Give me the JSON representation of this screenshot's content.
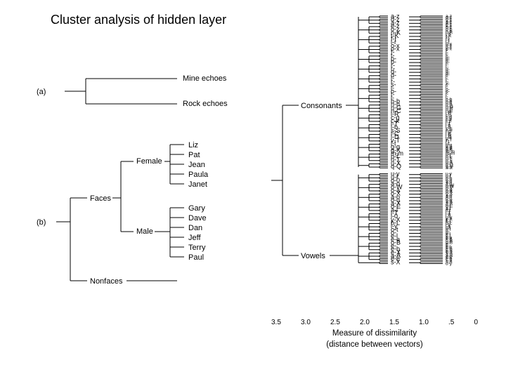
{
  "title": "Cluster analysis of hidden layer",
  "panel_a": {
    "tag": "(a)",
    "leaves": [
      "Mine echoes",
      "Rock echoes"
    ]
  },
  "panel_b": {
    "tag": "(b)",
    "root_labels": [
      "Faces",
      "Nonfaces"
    ],
    "gender": [
      "Female",
      "Male"
    ],
    "female": [
      "Liz",
      "Pat",
      "Jean",
      "Paula",
      "Janet"
    ],
    "male": [
      "Gary",
      "Dave",
      "Dan",
      "Jeff",
      "Terry",
      "Paul"
    ]
  },
  "panel_c": {
    "groups": [
      "Consonants",
      "Vowels"
    ],
    "consonants_pairs": [
      "a-z",
      "d-z",
      "a-z",
      "e-z",
      "o-z",
      "n-K",
      "t-K",
      "f-r",
      "l-r",
      "o-x",
      "o-x",
      "f-",
      "t-",
      "p-",
      "b-",
      "r-",
      "r-",
      "d-",
      "d-",
      "l-",
      "r-",
      "s-",
      "l-",
      "o-",
      "t-",
      "l-",
      "h-b",
      "h-h",
      "n-G",
      "n-C",
      "l-R",
      "c-q",
      "c-k",
      "l-T",
      "l-b",
      "s-S",
      "l-C",
      "l-D",
      "v-T",
      "l-t",
      "g-g",
      "g-K",
      "m-m",
      "p-f",
      "u-T",
      "u-X",
      "q-Q"
    ],
    "vowels_pairs": [
      "u-y",
      "u-l",
      "o-0",
      "a-o",
      "o-W",
      "o-a",
      "o-X",
      "a-o",
      "o-u",
      "a-X",
      "o-E",
      "a-l",
      "l-T",
      "l-0",
      "y-X",
      "b-L",
      "l-y",
      "o-t",
      "o-",
      "e-l",
      "e-e",
      "o-B",
      "e-",
      "e-b",
      "e-X",
      "a-A",
      "e-e",
      "s-X"
    ]
  },
  "axis": {
    "ticks": [
      "3.5",
      "3.0",
      "2.5",
      "2.0",
      "1.5",
      "1.0",
      ".5",
      "0"
    ],
    "label1": "Measure of dissimilarity",
    "label2": "(distance between vectors)"
  }
}
